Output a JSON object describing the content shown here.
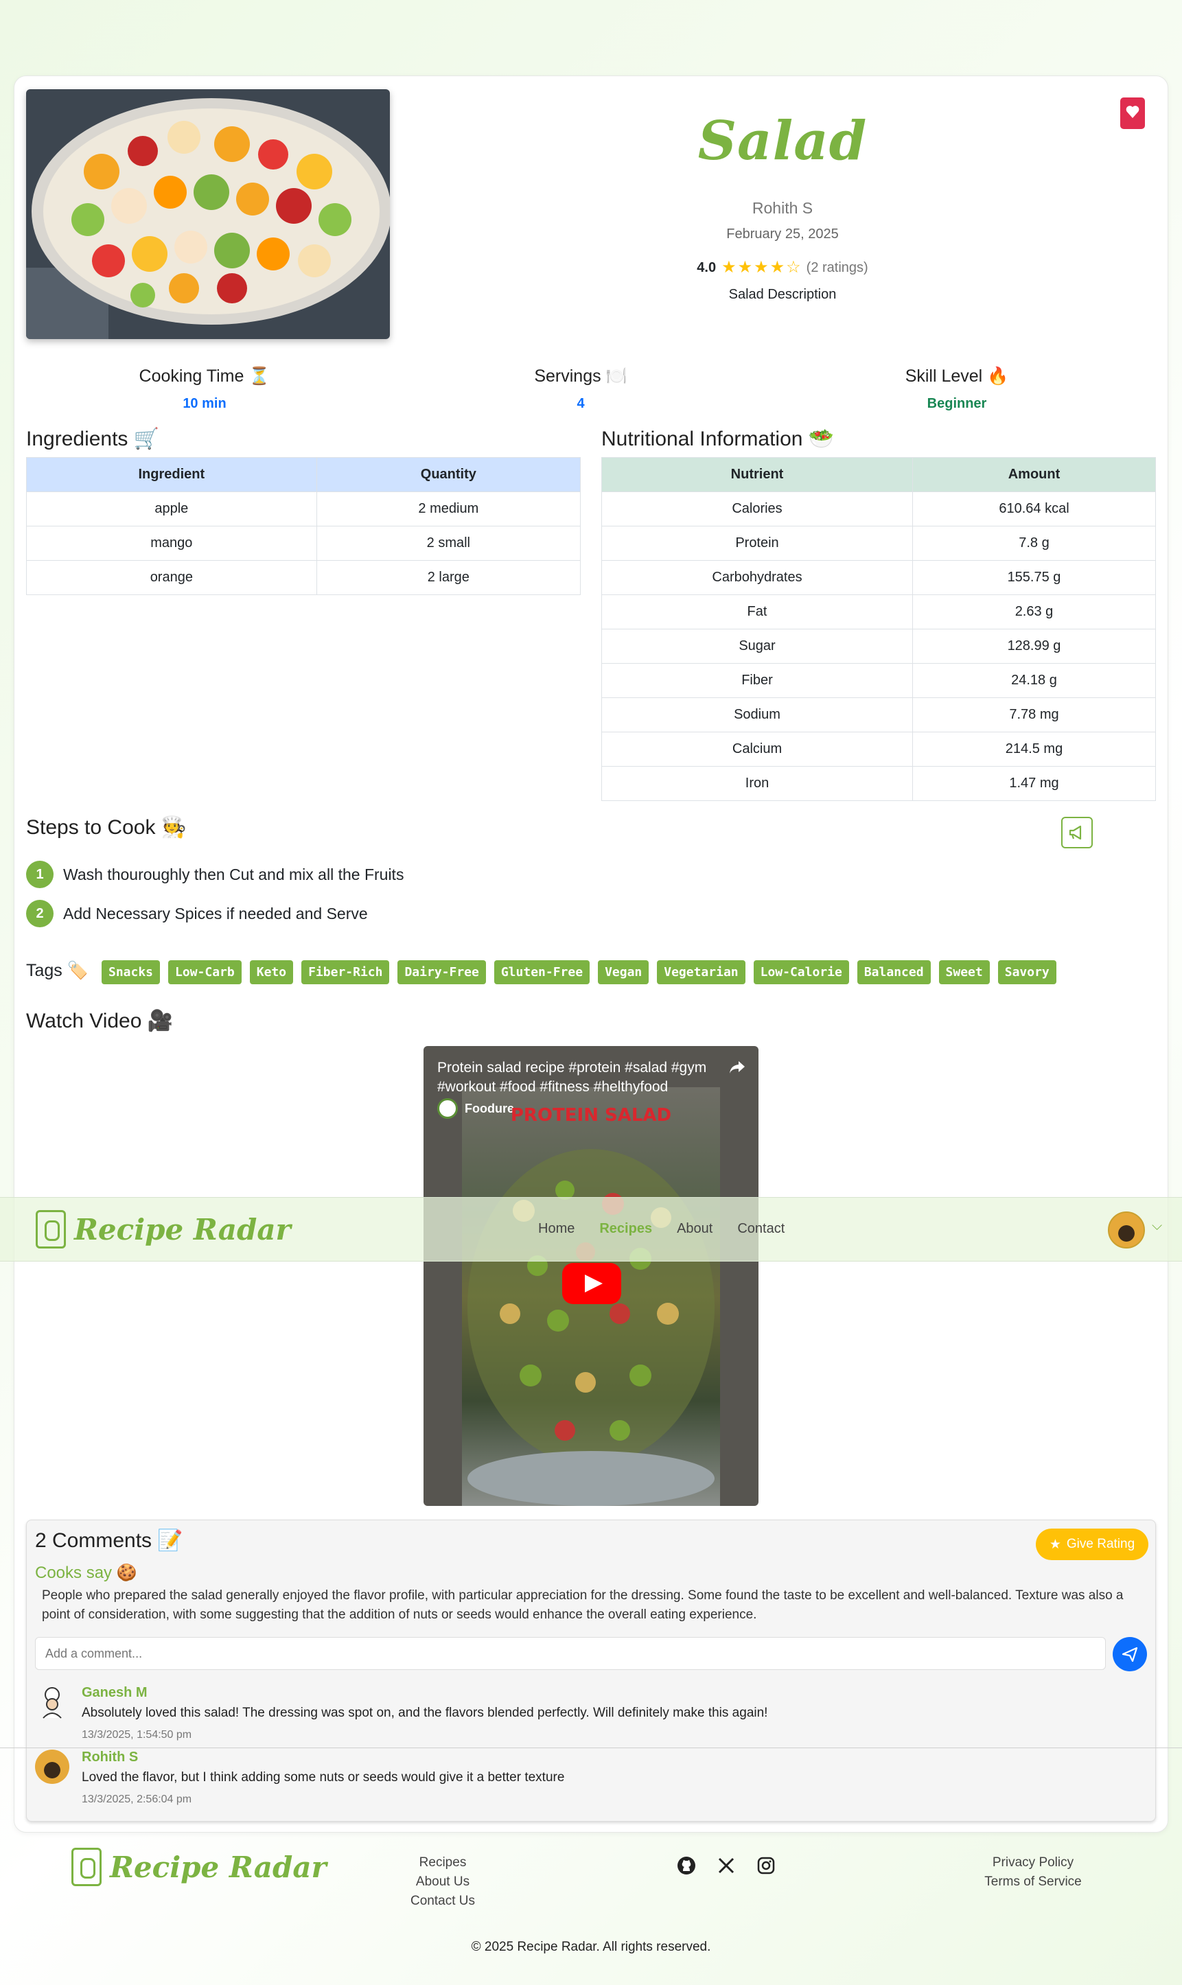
{
  "recipe": {
    "title": "Salad",
    "author": "Rohith S",
    "date": "February 25, 2025",
    "rating": "4.0",
    "rating_count": "(2 ratings)",
    "stars_filled": 4,
    "description": "Salad Description"
  },
  "stats": {
    "cooking_time": {
      "label": "Cooking Time ⏳",
      "value": "10 min"
    },
    "servings": {
      "label": "Servings 🍽️",
      "value": "4"
    },
    "skill": {
      "label": "Skill Level 🔥",
      "value": "Beginner"
    }
  },
  "ingredients": {
    "heading": "Ingredients 🛒",
    "columns": [
      "Ingredient",
      "Quantity"
    ],
    "rows": [
      [
        "apple",
        "2 medium"
      ],
      [
        "mango",
        "2 small"
      ],
      [
        "orange",
        "2 large"
      ]
    ]
  },
  "nutrition": {
    "heading": "Nutritional Information 🥗",
    "columns": [
      "Nutrient",
      "Amount"
    ],
    "rows": [
      [
        "Calories",
        "610.64 kcal"
      ],
      [
        "Protein",
        "7.8 g"
      ],
      [
        "Carbohydrates",
        "155.75 g"
      ],
      [
        "Fat",
        "2.63 g"
      ],
      [
        "Sugar",
        "128.99 g"
      ],
      [
        "Fiber",
        "24.18 g"
      ],
      [
        "Sodium",
        "7.78 mg"
      ],
      [
        "Calcium",
        "214.5 mg"
      ],
      [
        "Iron",
        "1.47 mg"
      ]
    ]
  },
  "steps": {
    "heading": "Steps to Cook 🧑‍🍳",
    "items": [
      "Wash thouroughly then Cut and mix all the Fruits",
      "Add Necessary Spices if needed and Serve"
    ]
  },
  "tags": {
    "heading": "Tags 🏷️",
    "items": [
      "Snacks",
      "Low-Carb",
      "Keto",
      "Fiber-Rich",
      "Dairy-Free",
      "Gluten-Free",
      "Vegan",
      "Vegetarian",
      "Low-Calorie",
      "Balanced",
      "Sweet",
      "Savory"
    ]
  },
  "video": {
    "heading": "Watch Video 🎥",
    "title": "Protein salad recipe #protein #salad #gym #workout #food #fitness #helthyfood",
    "channel": "Foodure",
    "overlay_text": "PROTEIN SALAD"
  },
  "navbar": {
    "brand": "Recipe Radar",
    "links": [
      "Home",
      "Recipes",
      "About",
      "Contact"
    ],
    "active": "Recipes"
  },
  "comments": {
    "heading": "2 Comments 📝",
    "give_rating": "Give Rating",
    "cooks_say": "Cooks say 🍪",
    "summary": "People who prepared the salad generally enjoyed the flavor profile, with particular appreciation for the dressing. Some found the taste to be excellent and well-balanced. Texture was also a point of consideration, with some suggesting that the addition of nuts or seeds would enhance the overall eating experience.",
    "input_placeholder": "Add a comment...",
    "items": [
      {
        "name": "Ganesh M",
        "text": "Absolutely loved this salad! The dressing was spot on, and the flavors blended perfectly. Will definitely make this again!",
        "time": "13/3/2025, 1:54:50 pm"
      },
      {
        "name": "Rohith S",
        "text": "Loved the flavor, but I think adding some nuts or seeds would give it a better texture",
        "time": "13/3/2025, 2:56:04 pm"
      }
    ]
  },
  "footer": {
    "brand": "Recipe Radar",
    "links": [
      "Recipes",
      "About Us",
      "Contact Us"
    ],
    "legal": [
      "Privacy Policy",
      "Terms of Service"
    ],
    "social": [
      "github-icon",
      "x-icon",
      "instagram-icon"
    ],
    "copyright": "© 2025 Recipe Radar. All rights reserved."
  },
  "colors": {
    "accent": "#7cb342",
    "blue": "#0d6efd",
    "bookmark": "#e02d4f",
    "rating": "#ffc107"
  }
}
